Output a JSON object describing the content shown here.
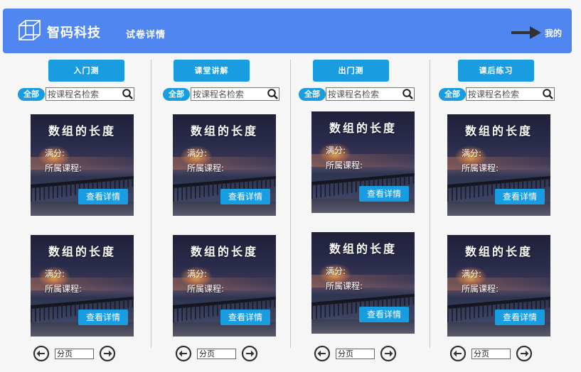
{
  "header": {
    "logo_text": "智码科技",
    "page_title": "试卷详情",
    "mine_label": "我的",
    "bg_color": "#4f86f0"
  },
  "icons": {
    "logo": "cube-outline-icon",
    "arrow": "arrow-right-icon",
    "search": "search-icon",
    "prev": "circle-arrow-left-icon",
    "next": "circle-arrow-right-icon"
  },
  "accent_color": "#1a9de0",
  "columns": [
    {
      "tab_label": "入门测",
      "filter_label": "全部",
      "search_placeholder": "按课程名检索",
      "cards": [
        {
          "title": "数组的长度",
          "score_label": "满分:",
          "course_label": "所属课程:",
          "button": "查看详情"
        },
        {
          "title": "数组的长度",
          "score_label": "满分:",
          "course_label": "所属课程:",
          "button": "查看详情"
        }
      ],
      "pager_value": "分页"
    },
    {
      "tab_label": "课堂讲解",
      "filter_label": "全部",
      "search_placeholder": "按课程名检索",
      "cards": [
        {
          "title": "数组的长度",
          "score_label": "满分:",
          "course_label": "所属课程:",
          "button": "查看详情"
        },
        {
          "title": "数组的长度",
          "score_label": "满分:",
          "course_label": "所属课程:",
          "button": "查看详情"
        }
      ],
      "pager_value": "分页"
    },
    {
      "tab_label": "出门测",
      "filter_label": "全部",
      "search_placeholder": "按课程名检索",
      "cards": [
        {
          "title": "数组的长度",
          "score_label": "满分:",
          "course_label": "所属课程:",
          "button": "查看详情"
        },
        {
          "title": "数组的长度",
          "score_label": "满分:",
          "course_label": "所属课程:",
          "button": "查看详情"
        }
      ],
      "pager_value": "分页"
    },
    {
      "tab_label": "课后练习",
      "filter_label": "全部",
      "search_placeholder": "按课程名检索",
      "cards": [
        {
          "title": "数组的长度",
          "score_label": "满分:",
          "course_label": "所属课程:",
          "button": "查看详情"
        },
        {
          "title": "数组的长度",
          "score_label": "满分:",
          "course_label": "所属课程:",
          "button": "查看详情"
        }
      ],
      "pager_value": "分页"
    }
  ]
}
